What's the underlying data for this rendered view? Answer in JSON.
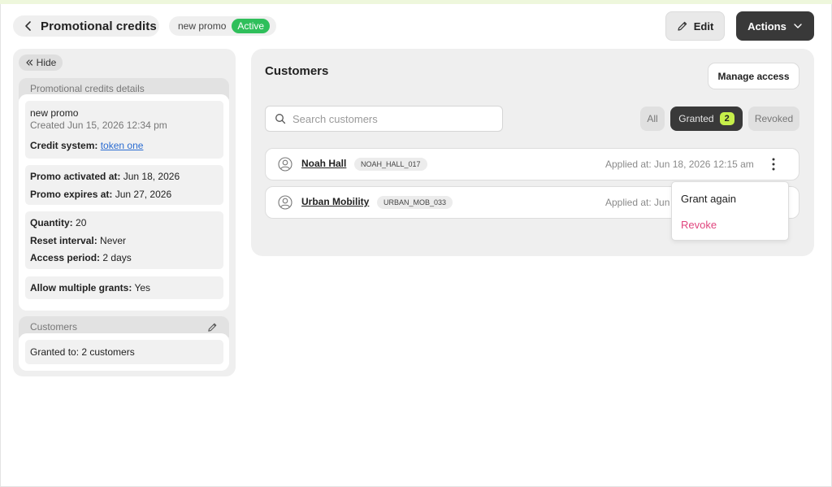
{
  "header": {
    "back_title": "Promotional credits",
    "promo_name": "new promo",
    "status": "Active",
    "edit_label": "Edit",
    "actions_label": "Actions"
  },
  "details": {
    "hide_label": "Hide",
    "section_title": "Promotional credits details",
    "name": "new promo",
    "created": "Created Jun 15, 2026 12:34 pm",
    "credit_system_label": "Credit system:",
    "credit_system_value": "token one",
    "activated_label": "Promo activated at:",
    "activated_value": "Jun 18, 2026",
    "expires_label": "Promo expires at:",
    "expires_value": "Jun 27, 2026",
    "quantity_label": "Quantity:",
    "quantity_value": "20",
    "reset_label": "Reset interval:",
    "reset_value": "Never",
    "access_label": "Access period:",
    "access_value": "2 days",
    "multiple_label": "Allow multiple grants:",
    "multiple_value": "Yes"
  },
  "customers_section": {
    "title": "Customers",
    "granted_text": "Granted to: 2 customers"
  },
  "customers": {
    "title": "Customers",
    "manage_label": "Manage access",
    "search_placeholder": "Search customers",
    "filters": {
      "all": "All",
      "granted": "Granted",
      "granted_count": "2",
      "revoked": "Revoked"
    },
    "rows": [
      {
        "name": "Noah Hall",
        "code": "NOAH_HALL_017",
        "applied": "Applied at: Jun 18, 2026 12:15 am"
      },
      {
        "name": "Urban Mobility",
        "code": "URBAN_MOB_033",
        "applied": "Applied at: Jun"
      }
    ],
    "menu": {
      "grant_again": "Grant again",
      "revoke": "Revoke"
    }
  },
  "colors": {
    "active_badge": "#2fbf5b",
    "dark_button": "#393939",
    "count_badge": "#c6ef4a",
    "link": "#2a6bd1",
    "revoke": "#e0457e"
  }
}
